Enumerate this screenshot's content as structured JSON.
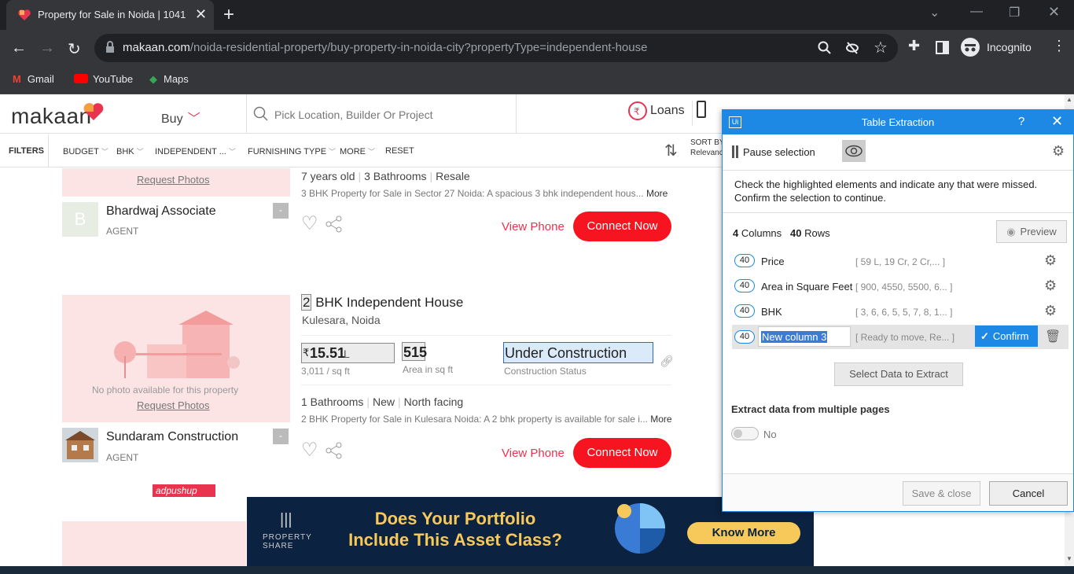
{
  "browser": {
    "tab_title": "Property for Sale in Noida | 1041",
    "url_domain": "makaan.com",
    "url_path": "/noida-residential-property/buy-property-in-noida-city?propertyType=independent-house",
    "profile_label": "Incognito",
    "bookmarks": [
      "Gmail",
      "YouTube",
      "Maps"
    ]
  },
  "site": {
    "logo": "makaan",
    "buy_label": "Buy",
    "search_placeholder": "Pick Location, Builder Or Project",
    "loans_label": "Loans",
    "download_label": "D",
    "sort_label": "SORT BY",
    "sort_value": "Relevanc"
  },
  "filters": {
    "filters_label": "FILTERS",
    "items": [
      "BUDGET",
      "BHK",
      "INDEPENDENT ...",
      "FURNISHING TYPE",
      "MORE",
      "RESET"
    ]
  },
  "listing1": {
    "request_photos": "Request Photos",
    "meta": [
      "7 years old",
      "3 Bathrooms",
      "Resale"
    ],
    "desc": "3 BHK Property for Sale in Sector 27 Noida:  A spacious 3 bhk independent hous...",
    "more": "More",
    "agent_name": "Bhardwaj Associate",
    "agent_initial": "B",
    "agent_role": "AGENT",
    "view_phone": "View Phone",
    "connect": "Connect Now"
  },
  "listing2": {
    "title_num": "2",
    "title_rest": " BHK Independent House",
    "location": "Kulesara, Noida",
    "price_symbol": "₹",
    "price": "15.51",
    "price_unit": "L",
    "price_sqft": "3,011 / sq ft",
    "area": "515",
    "area_label": "Area in sq ft",
    "status": "Under Construction",
    "status_label": "Construction Status",
    "no_photo": "No photo available for this property",
    "request_photos": "Request Photos",
    "meta": [
      "1 Bathrooms",
      "New",
      "North facing"
    ],
    "desc": "2 BHK Property for Sale in Kulesara Noida:  A 2 bhk property is available for sale i...",
    "more": "More",
    "agent_name": "Sundaram Construction",
    "agent_role": "AGENT",
    "view_phone": "View Phone",
    "connect": "Connect Now"
  },
  "ad": {
    "adpushup": "adpushup",
    "brand_line1": "PROPERTY",
    "brand_line2": "SHARE",
    "headline_1": "Does Your  Portfolio",
    "headline_2": "Include This Asset Class?",
    "cta": "Know More"
  },
  "dialog": {
    "title": "Table Extraction",
    "help": "?",
    "pause": "Pause selection",
    "instructions_1": "Check the highlighted elements and indicate any that were missed.",
    "instructions_2": "Confirm the selection to continue.",
    "columns_count": "4",
    "columns_label": "Columns",
    "rows_count": "40",
    "rows_label": "Rows",
    "preview": "Preview",
    "columns": [
      {
        "count": "40",
        "name": "Price",
        "values": "[ 59 L,  19 Cr,  2 Cr,... ]"
      },
      {
        "count": "40",
        "name": "Area in Square Feet",
        "values": "[ 900, 4550, 5500, 6... ]"
      },
      {
        "count": "40",
        "name": "BHK",
        "values": "[ 3, 6, 6, 5, 5, 7, 8, 1... ]"
      },
      {
        "count": "40",
        "name": "New column 3",
        "values": "[ Ready to move, Re... ]"
      }
    ],
    "confirm": "Confirm",
    "select_data": "Select Data to Extract",
    "multi_pages": "Extract data from multiple pages",
    "toggle_value": "No",
    "save_close": "Save & close",
    "cancel": "Cancel"
  },
  "colors": {
    "brand_red": "#e8344e",
    "connect_red": "#f5141f",
    "dialog_blue": "#1e88e5",
    "ad_bg": "#0b2240",
    "ad_yellow": "#f7c85a"
  }
}
